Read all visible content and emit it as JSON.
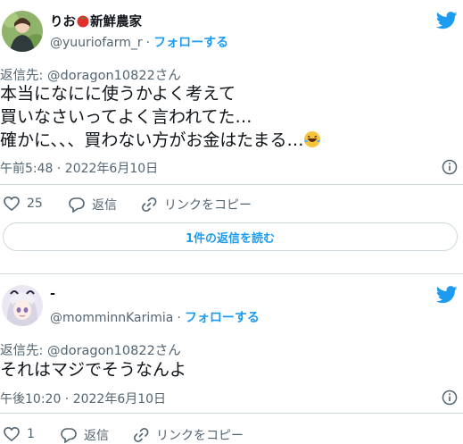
{
  "tweets": [
    {
      "display_name": "りお",
      "display_name_suffix": "新鮮農家",
      "handle": "@yuuriofarm_r",
      "separator": "·",
      "follow_label": "フォローする",
      "reply_to": "返信先: @doragon10822さん",
      "text_lines": [
        "本当になにに使うかよく考えて",
        "買いなさいってよく言われてた…",
        "確かに、、、買わない方がお金はたまる…"
      ],
      "timestamp": "午前5:48 · 2022年6月10日",
      "like_count": "25",
      "reply_label": "返信",
      "copy_link_label": "リンクをコピー",
      "read_replies_label": "1件の返信を読む"
    },
    {
      "display_name": "-",
      "handle": "@momminnKarimia",
      "separator": "·",
      "follow_label": "フォローする",
      "reply_to": "返信先: @doragon10822さん",
      "text_lines": [
        "それはマジでそうなんよ"
      ],
      "timestamp": "午後10:20 · 2022年6月10日",
      "like_count": "1",
      "reply_label": "返信",
      "copy_link_label": "リンクをコピー"
    }
  ],
  "icons": [
    "twitter-bird-icon",
    "info-icon",
    "heart-icon",
    "reply-bubble-icon",
    "link-icon",
    "tomato-emoji",
    "laughing-emoji"
  ],
  "colors": {
    "accent": "#1d9bf0",
    "text": "#0f1419",
    "secondary": "#536471",
    "border": "#cfd9de"
  }
}
